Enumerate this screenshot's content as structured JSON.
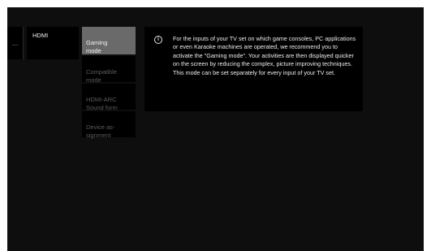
{
  "menu": {
    "previous_label": "...",
    "current_label": "HDMI"
  },
  "submenu": {
    "items": [
      {
        "label": "Gaming\nmode",
        "active": true
      },
      {
        "label": "Compatible\nmode",
        "active": false
      },
      {
        "label": "HDMI-ARC\nSound form",
        "active": false
      },
      {
        "label": "Device as-\nsignment",
        "active": false
      }
    ]
  },
  "info": {
    "icon": "info-icon",
    "icon_glyph": "i",
    "text": "For the inputs of your TV set on which game consoles, PC applications or even Karaoke machines are operated, we recommend you to activate the \"Gaming mode\". Your activities are then displayed quicker on the screen by reducing the complex, picture improving techniques. This mode can be set separately for every input of your TV set."
  },
  "colors": {
    "background": "#0e0e0e",
    "panel": "#000000",
    "active_item": "#6a6a6a",
    "text": "#ededed",
    "dimmed_text": "#5c5c5c"
  }
}
